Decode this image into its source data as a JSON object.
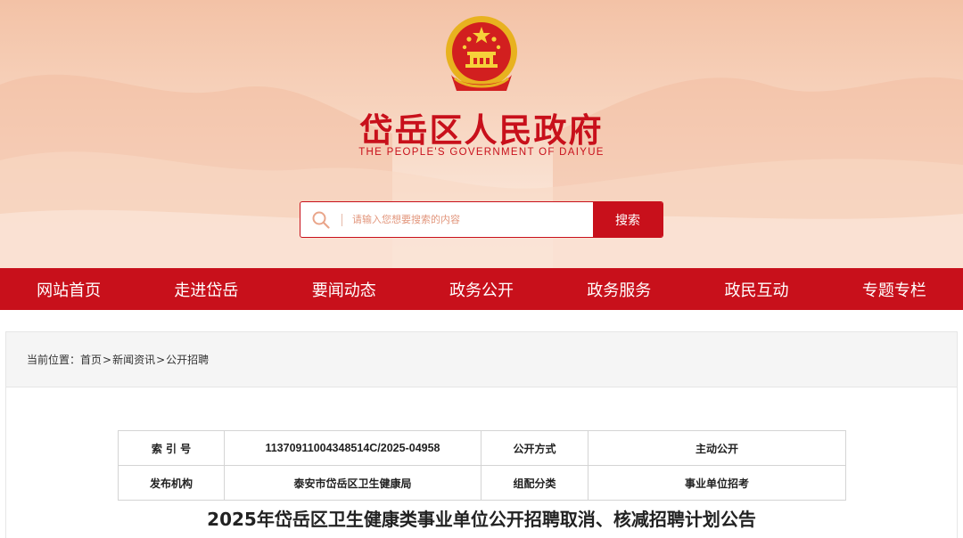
{
  "header": {
    "title": "岱岳区人民政府",
    "subtitle": "THE PEOPLE'S GOVERNMENT OF DAIYUE",
    "emblem_icon": "national-emblem-icon"
  },
  "search": {
    "placeholder": "请输入您想要搜索的内容",
    "button_label": "搜索",
    "icon": "search-icon"
  },
  "nav": {
    "items": [
      {
        "label": "网站首页"
      },
      {
        "label": "走进岱岳"
      },
      {
        "label": "要闻动态"
      },
      {
        "label": "政务公开"
      },
      {
        "label": "政务服务"
      },
      {
        "label": "政民互动"
      },
      {
        "label": "专题专栏"
      }
    ]
  },
  "breadcrumb": {
    "prefix": "当前位置：",
    "items": [
      "首页",
      "新闻资讯",
      "公开招聘"
    ],
    "separator": ">"
  },
  "info": {
    "index_label": "索 引 号",
    "index_value": "11370911004348514C/2025-04958",
    "method_label": "公开方式",
    "method_value": "主动公开",
    "org_label": "发布机构",
    "org_value": "泰安市岱岳区卫生健康局",
    "category_label": "组配分类",
    "category_value": "事业单位招考"
  },
  "article": {
    "title": "2025年岱岳区卫生健康类事业单位公开招聘取消、核减招聘计划公告"
  },
  "colors": {
    "brand_red": "#c8101b",
    "header_bg": "#f7d3bd",
    "breadcrumb_bg": "#f5f5f5"
  }
}
